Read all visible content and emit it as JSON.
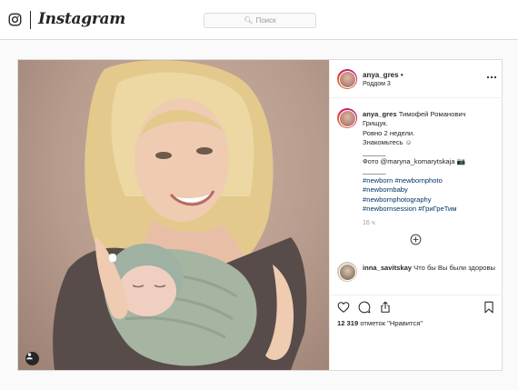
{
  "nav": {
    "wordmark": "Instagram",
    "search_placeholder": "Поиск",
    "icons": [
      "instagram-camera-icon",
      "search-icon"
    ]
  },
  "post": {
    "username": "anya_gres",
    "follow_dot": "•",
    "location": "Роддом 3",
    "caption_lines": [
      "Тимофей Романович",
      "Грищук.",
      "Ровно 2 недели.",
      "Знакомьтесь ☺",
      "______",
      "Фото @maryna_komarytskaja 📷",
      "______",
      "#newborn #newbornphoto",
      "#newbornbaby",
      "#newbornphotography",
      "#newbornsession #ГриГреТим"
    ],
    "time": "16 ч.",
    "comment": {
      "username": "inna_savitskay",
      "text": "Что бы Вы были здоровы"
    },
    "likes_count": "12 319",
    "likes_label": "отметок \"Нравится\"",
    "colors": {
      "link": "#003569",
      "muted": "#999999",
      "border": "#dbdbdb"
    },
    "icons": [
      "heart-icon",
      "comment-icon",
      "share-icon",
      "bookmark-icon",
      "more-icon",
      "add-comment-icon",
      "tagged-user-icon"
    ]
  }
}
